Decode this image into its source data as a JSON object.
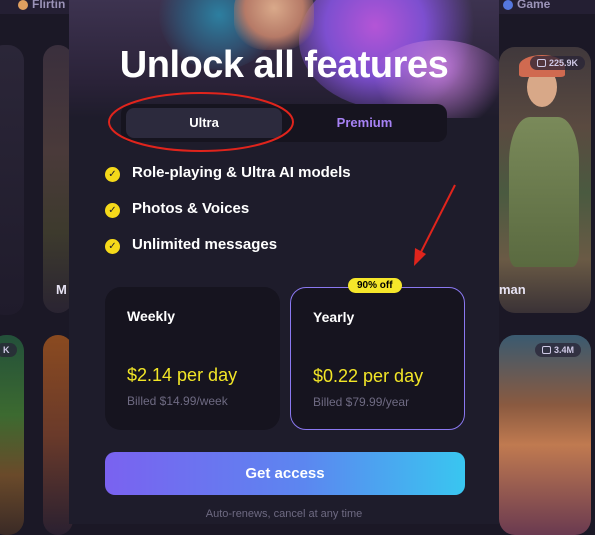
{
  "background": {
    "tabs": [
      "Flirtin",
      "Game"
    ],
    "names": [
      "M",
      "man"
    ],
    "badges": [
      "225.9K",
      "3.4M",
      "K"
    ]
  },
  "modal": {
    "title": "Unlock all features",
    "plan_toggle": {
      "options": [
        "Ultra",
        "Premium"
      ],
      "selected": "Ultra"
    },
    "features": [
      "Role-playing & Ultra AI models",
      "Photos & Voices",
      "Unlimited messages"
    ],
    "plans": [
      {
        "name": "Weekly",
        "price": "$2.14 per day",
        "billed": "Billed $14.99/week"
      },
      {
        "name": "Yearly",
        "price": "$0.22 per day",
        "billed": "Billed $79.99/year",
        "badge": "90% off",
        "selected": true
      }
    ],
    "cta_label": "Get access",
    "footnote": "Auto-renews, cancel at any time"
  },
  "colors": {
    "accent_yellow": "#f2e627",
    "premium_purple": "#a782f5",
    "annotation_red": "#e0241c",
    "cta_gradient": [
      "#7a62f0",
      "#39c6f0"
    ]
  }
}
